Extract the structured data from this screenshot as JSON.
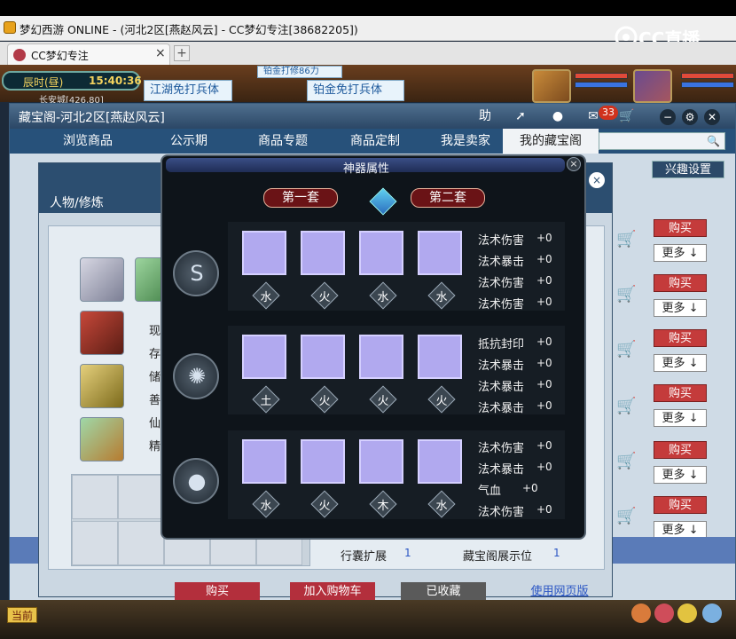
{
  "os_title": "梦幻西游 ONLINE - (河北2区[燕赵风云] - CC梦幻专注[38682205])",
  "watermark": "CC直播",
  "browser": {
    "tab_label": "CC梦幻专注",
    "tab_close": "×",
    "new_tab": "+"
  },
  "game_hud": {
    "time_label": "辰时(昼)",
    "clock": "15:40:36",
    "location": "长安城[426,80]",
    "banner_top": "铂金打修86力",
    "banner_left": "江湖免打兵体",
    "banner_right": "铂金免打兵体"
  },
  "main_window": {
    "title": "藏宝阁-河北2区[燕赵风云]",
    "help_label": "助",
    "message_count": "33",
    "nav_tabs": [
      "浏览商品",
      "公示期",
      "商品专题",
      "商品定制",
      "我是卖家",
      "我的藏宝阁"
    ],
    "interest_button": "兴趣设置",
    "buy_label": "购买",
    "more_label": "更多 ↓"
  },
  "detail_window": {
    "tab_char": "人物/修炼",
    "close": "×",
    "side_chars": [
      "现",
      "存",
      "储",
      "善",
      "仙",
      "精"
    ],
    "info": {
      "bag_label": "行囊扩展",
      "bag_value": "1",
      "display_label": "藏宝阁展示位",
      "display_value": "1"
    },
    "bottom_buttons": {
      "buy": "购买",
      "add_to_cart": "加入购物车",
      "favorited": "已收藏",
      "web_version": "使用网页版"
    }
  },
  "artifact_panel": {
    "title": "神器属性",
    "close": "×",
    "set1": "第一套",
    "set2": "第二套",
    "rows": [
      {
        "slots": [
          "水",
          "火",
          "水",
          "水"
        ],
        "attrs": [
          {
            "name": "法术伤害",
            "value": "+0"
          },
          {
            "name": "法术暴击",
            "value": "+0"
          },
          {
            "name": "法术伤害",
            "value": "+0"
          },
          {
            "name": "法术伤害",
            "value": "+0"
          }
        ]
      },
      {
        "slots": [
          "土",
          "火",
          "火",
          "火"
        ],
        "attrs": [
          {
            "name": "抵抗封印",
            "value": "+0"
          },
          {
            "name": "法术暴击",
            "value": "+0"
          },
          {
            "name": "法术暴击",
            "value": "+0"
          },
          {
            "name": "法术暴击",
            "value": "+0"
          }
        ]
      },
      {
        "slots": [
          "水",
          "火",
          "木",
          "水"
        ],
        "attrs": [
          {
            "name": "法术伤害",
            "value": "+0"
          },
          {
            "name": "法术暴击",
            "value": "+0"
          },
          {
            "name": "气血",
            "value": "+0"
          },
          {
            "name": "法术伤害",
            "value": "+0"
          }
        ]
      }
    ]
  },
  "game_bottom": {
    "current_label": "当前"
  }
}
